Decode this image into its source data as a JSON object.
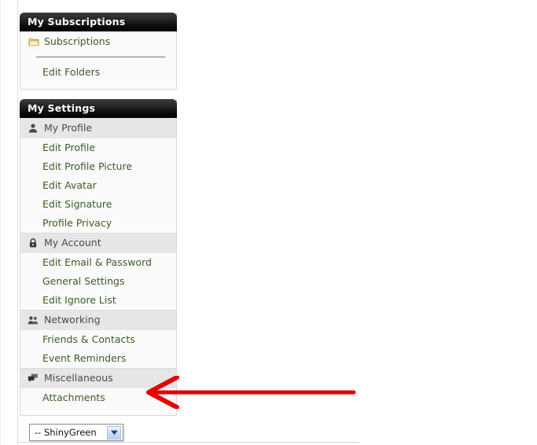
{
  "theme": {
    "header_bg": "#111111",
    "link_color": "#3d5c24",
    "category_bg": "#e6e6e6",
    "panel_bg": "#fafafa",
    "annotation_color": "#e60000"
  },
  "subscriptions_panel": {
    "title": "My Subscriptions",
    "root_item": {
      "label": "Subscriptions",
      "icon": "folder-icon"
    },
    "links": [
      {
        "label": "Edit Folders"
      }
    ]
  },
  "settings_panel": {
    "title": "My Settings",
    "groups": [
      {
        "label": "My Profile",
        "icon": "user-icon",
        "items": [
          {
            "label": "Edit Profile"
          },
          {
            "label": "Edit Profile Picture"
          },
          {
            "label": "Edit Avatar"
          },
          {
            "label": "Edit Signature"
          },
          {
            "label": "Profile Privacy"
          }
        ]
      },
      {
        "label": "My Account",
        "icon": "lock-icon",
        "items": [
          {
            "label": "Edit Email & Password"
          },
          {
            "label": "General Settings"
          },
          {
            "label": "Edit Ignore List"
          }
        ]
      },
      {
        "label": "Networking",
        "icon": "users-icon",
        "items": [
          {
            "label": "Friends & Contacts"
          },
          {
            "label": "Event Reminders"
          }
        ]
      },
      {
        "label": "Miscellaneous",
        "icon": "chat-bubbles-icon",
        "items": [
          {
            "label": "Attachments"
          }
        ]
      }
    ]
  },
  "theme_selector": {
    "selected": "-- ShinyGreen",
    "arrow_icon": "chevron-down-icon"
  },
  "annotation": {
    "type": "arrow-left",
    "points_to": "Attachments"
  }
}
